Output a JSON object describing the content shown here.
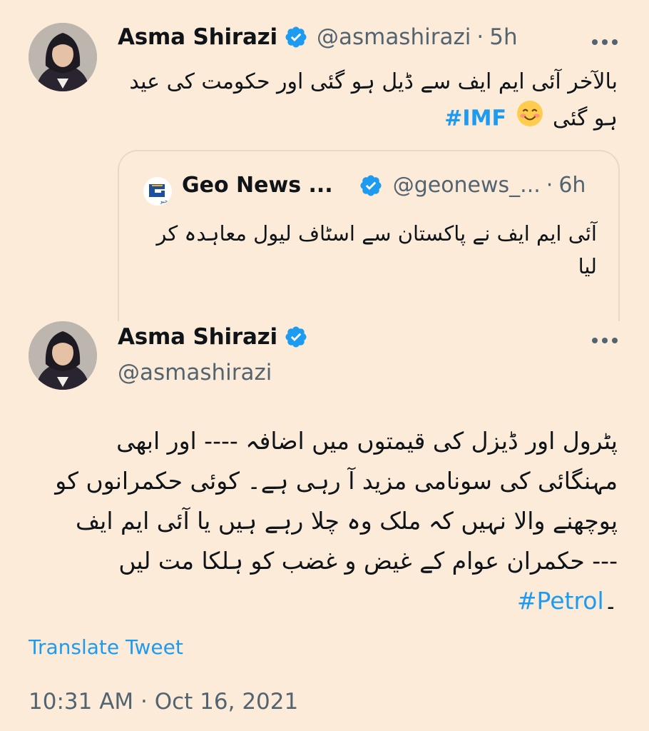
{
  "tweet1": {
    "name": "Asma Shirazi",
    "handle": "@asmashirazi",
    "separator": "·",
    "time": "5h",
    "text_line1": "بالآخر آئی ایم ایف سے ڈیل ہو گئی اور حکومت کی عید",
    "text_line2": "ہو گئی",
    "hashtag": "#IMF",
    "emoji": "smiling-face-with-smiling-eyes"
  },
  "quote": {
    "name": "Geo News ...",
    "handle": "@geonews_...",
    "separator": "·",
    "time": "6h",
    "text_line1": "آئی ایم ایف نے پاکستان سے اسٹاف لیول معاہدہ کر",
    "text_line2": "لیا"
  },
  "tweet2": {
    "name": "Asma Shirazi",
    "handle": "@asmashirazi",
    "lines": [
      "پٹرول اور ڈیزل کی قیمتوں میں اضافہ ---- اور ابھی",
      "مہنگائی کی سونامی مزید آ رہی ہے۔ کوئی حکمرانوں کو",
      "پوچھنے والا نہیں کہ ملک وہ چلا رہے ہیں یا آئی ایم ایف",
      "--- حکمران عوام کے غیض و غضب کو ہلکا مت لیں"
    ],
    "hashtag": "#Petrol",
    "hashtag_suffix": "۔",
    "translate_label": "Translate Tweet",
    "timestamp": "10:31 AM · Oct 16, 2021"
  },
  "colors": {
    "background": "#fcebd9",
    "link": "#1d9bf0",
    "muted": "#536471",
    "verified": "#1d9bf0"
  }
}
